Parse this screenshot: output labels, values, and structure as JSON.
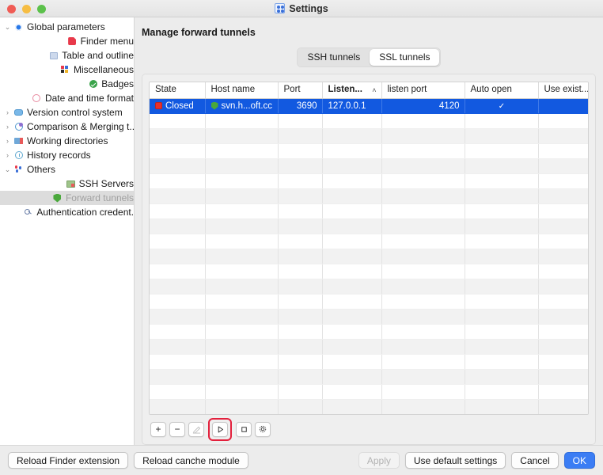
{
  "window": {
    "title": "Settings",
    "title_icon": "settings-nodes-icon",
    "traffic_lights": [
      "close",
      "minimize",
      "zoom"
    ]
  },
  "sidebar": {
    "items": [
      {
        "label": "Global parameters",
        "icon": "gear-icon",
        "twisty": "⌄",
        "level": 0,
        "expanded": true,
        "selected": false
      },
      {
        "label": "Finder menu",
        "icon": "finder-icon",
        "twisty": "",
        "level": 1,
        "expanded": false,
        "selected": false
      },
      {
        "label": "Table and outline",
        "icon": "table-icon",
        "twisty": "",
        "level": 1,
        "expanded": false,
        "selected": false
      },
      {
        "label": "Miscellaneous",
        "icon": "miscellaneous-icon",
        "twisty": "",
        "level": 1,
        "expanded": false,
        "selected": false
      },
      {
        "label": "Badges",
        "icon": "badge-check-icon",
        "twisty": "",
        "level": 1,
        "expanded": false,
        "selected": false
      },
      {
        "label": "Date and time format",
        "icon": "clock-icon",
        "twisty": "",
        "level": 1,
        "expanded": false,
        "selected": false
      },
      {
        "label": "Version control system",
        "icon": "vcs-cloud-icon",
        "twisty": "›",
        "level": 0,
        "expanded": false,
        "selected": false
      },
      {
        "label": "Comparison & Merging t...",
        "icon": "merge-icon",
        "twisty": "›",
        "level": 0,
        "expanded": false,
        "selected": false
      },
      {
        "label": "Working directories",
        "icon": "folder-icon",
        "twisty": "›",
        "level": 0,
        "expanded": false,
        "selected": false
      },
      {
        "label": "History records",
        "icon": "history-clock-icon",
        "twisty": "›",
        "level": 0,
        "expanded": false,
        "selected": false
      },
      {
        "label": "Others",
        "icon": "others-dots-icon",
        "twisty": "⌄",
        "level": 0,
        "expanded": true,
        "selected": false
      },
      {
        "label": "SSH Servers",
        "icon": "server-icon",
        "twisty": "",
        "level": 1,
        "expanded": false,
        "selected": false
      },
      {
        "label": "Forward tunnels",
        "icon": "shield-icon",
        "twisty": "",
        "level": 1,
        "expanded": false,
        "selected": true
      },
      {
        "label": "Authentication credent...",
        "icon": "key-icon",
        "twisty": "",
        "level": 1,
        "expanded": false,
        "selected": false
      }
    ]
  },
  "main": {
    "pane_title": "Manage forward tunnels",
    "tabs": [
      {
        "label": "SSH tunnels",
        "active": false
      },
      {
        "label": "SSL tunnels",
        "active": true
      }
    ],
    "table": {
      "columns": [
        {
          "label": "State",
          "sorted": false,
          "align": "left"
        },
        {
          "label": "Host name",
          "sorted": false,
          "align": "left"
        },
        {
          "label": "Port",
          "sorted": false,
          "align": "right"
        },
        {
          "label": "Listen...",
          "sorted": true,
          "sort_arrow": "˄",
          "align": "left"
        },
        {
          "label": "listen port",
          "sorted": false,
          "align": "right"
        },
        {
          "label": "Auto open",
          "sorted": false,
          "align": "center"
        },
        {
          "label": "Use exist...",
          "sorted": false,
          "align": "center"
        }
      ],
      "rows": [
        {
          "selected": true,
          "state": "Closed",
          "state_icon": "stopped-red-square-icon",
          "host_name": "svn.h...oft.cc",
          "host_icon": "shield-icon",
          "port": "3690",
          "listen_address": "127.0.0.1",
          "listen_port": "4120",
          "auto_open": "✓",
          "use_existing": ""
        }
      ],
      "empty_row_count": 20
    },
    "toolbar": [
      {
        "name": "add-button",
        "glyph": "+",
        "enabled": true,
        "highlighted": false
      },
      {
        "name": "remove-button",
        "glyph": "−",
        "enabled": true,
        "highlighted": false
      },
      {
        "name": "edit-button",
        "glyph": "pencil",
        "enabled": false,
        "highlighted": false
      },
      {
        "name": "start-button",
        "glyph": "play",
        "enabled": true,
        "highlighted": true
      },
      {
        "name": "stop-button",
        "glyph": "square",
        "enabled": true,
        "highlighted": false
      },
      {
        "name": "settings-button",
        "glyph": "gear",
        "enabled": true,
        "highlighted": false
      }
    ],
    "highlight_color": "#e3203c"
  },
  "footer": {
    "left_buttons": [
      {
        "label": "Reload Finder extension",
        "style": "normal"
      },
      {
        "label": "Reload canche module",
        "style": "normal"
      }
    ],
    "right_buttons": [
      {
        "label": "Apply",
        "style": "disabled"
      },
      {
        "label": "Use default settings",
        "style": "normal"
      },
      {
        "label": "Cancel",
        "style": "normal"
      },
      {
        "label": "OK",
        "style": "primary"
      }
    ]
  },
  "colors": {
    "selection_blue": "#1259e0",
    "primary_button": "#3b7df4",
    "status_red": "#e8302b",
    "shield_green": "#4aa83c",
    "highlight_red": "#e3203c"
  }
}
